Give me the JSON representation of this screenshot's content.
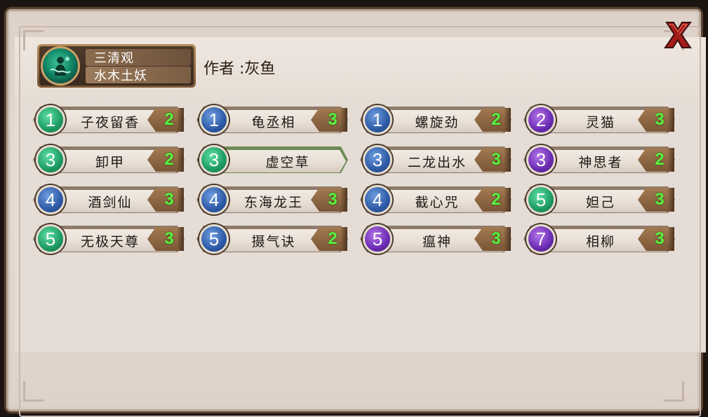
{
  "deck": {
    "name_line1": "三清观",
    "name_line2": "水木土妖",
    "icon": "jade-spirit-icon",
    "author": "作者 :灰鱼"
  },
  "close_icon": "close-x-icon",
  "colors": {
    "green": "#1d9a62",
    "blue": "#2e5aa6",
    "purple": "#6a2bb2",
    "quantity_text": "#5bf23f",
    "close_red": "#a41c1a"
  },
  "cards": [
    {
      "cost": "1",
      "color": "green",
      "name": "子夜留香",
      "qty": "2"
    },
    {
      "cost": "1",
      "color": "blue",
      "name": "龟丞相",
      "qty": "3"
    },
    {
      "cost": "1",
      "color": "blue",
      "name": "螺旋劲",
      "qty": "2"
    },
    {
      "cost": "2",
      "color": "purple",
      "name": "灵猫",
      "qty": "3"
    },
    {
      "cost": "3",
      "color": "green",
      "name": "卸甲",
      "qty": "2"
    },
    {
      "cost": "3",
      "color": "green",
      "name": "虚空草",
      "qty": ""
    },
    {
      "cost": "3",
      "color": "blue",
      "name": "二龙出水",
      "qty": "3"
    },
    {
      "cost": "3",
      "color": "purple",
      "name": "神思者",
      "qty": "2"
    },
    {
      "cost": "4",
      "color": "blue",
      "name": "酒剑仙",
      "qty": "3"
    },
    {
      "cost": "4",
      "color": "blue",
      "name": "东海龙王",
      "qty": "3"
    },
    {
      "cost": "4",
      "color": "blue",
      "name": "截心咒",
      "qty": "2"
    },
    {
      "cost": "5",
      "color": "green",
      "name": "妲己",
      "qty": "3"
    },
    {
      "cost": "5",
      "color": "green",
      "name": "无极天尊",
      "qty": "3"
    },
    {
      "cost": "5",
      "color": "blue",
      "name": "摄气诀",
      "qty": "2"
    },
    {
      "cost": "5",
      "color": "purple",
      "name": "瘟神",
      "qty": "3"
    },
    {
      "cost": "7",
      "color": "purple",
      "name": "相柳",
      "qty": "3"
    }
  ]
}
